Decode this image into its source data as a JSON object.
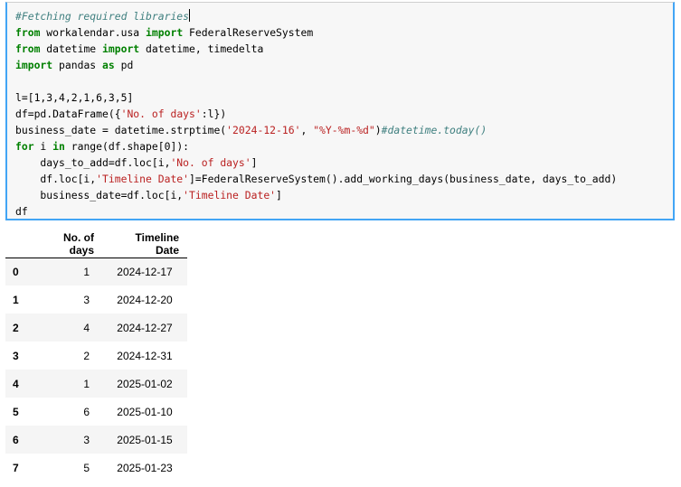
{
  "code_cell": {
    "lines": [
      [
        {
          "t": "cmt",
          "v": "#Fetching required libraries"
        }
      ],
      [
        {
          "t": "kw",
          "v": "from"
        },
        {
          "t": "plain",
          "v": " workalendar.usa "
        },
        {
          "t": "kw",
          "v": "import"
        },
        {
          "t": "plain",
          "v": " FederalReserveSystem"
        }
      ],
      [
        {
          "t": "kw",
          "v": "from"
        },
        {
          "t": "plain",
          "v": " datetime "
        },
        {
          "t": "kw",
          "v": "import"
        },
        {
          "t": "plain",
          "v": " datetime, timedelta"
        }
      ],
      [
        {
          "t": "kw",
          "v": "import"
        },
        {
          "t": "plain",
          "v": " pandas "
        },
        {
          "t": "kw",
          "v": "as"
        },
        {
          "t": "plain",
          "v": " pd"
        }
      ],
      [],
      [
        {
          "t": "plain",
          "v": "l=[1,3,4,2,1,6,3,5]"
        }
      ],
      [
        {
          "t": "plain",
          "v": "df=pd.DataFrame({"
        },
        {
          "t": "str",
          "v": "'No. of days'"
        },
        {
          "t": "plain",
          "v": ":l})"
        }
      ],
      [
        {
          "t": "plain",
          "v": "business_date = datetime.strptime("
        },
        {
          "t": "str",
          "v": "'2024-12-16'"
        },
        {
          "t": "plain",
          "v": ", "
        },
        {
          "t": "str",
          "v": "\"%Y-%m-%d\""
        },
        {
          "t": "plain",
          "v": ")"
        },
        {
          "t": "cmt",
          "v": "#datetime.today()"
        }
      ],
      [
        {
          "t": "kw",
          "v": "for"
        },
        {
          "t": "plain",
          "v": " i "
        },
        {
          "t": "kw",
          "v": "in"
        },
        {
          "t": "plain",
          "v": " range(df.shape[0]):"
        }
      ],
      [
        {
          "t": "plain",
          "v": "    days_to_add=df.loc[i,"
        },
        {
          "t": "str",
          "v": "'No. of days'"
        },
        {
          "t": "plain",
          "v": "]"
        }
      ],
      [
        {
          "t": "plain",
          "v": "    df.loc[i,"
        },
        {
          "t": "str",
          "v": "'Timeline Date'"
        },
        {
          "t": "plain",
          "v": "]=FederalReserveSystem().add_working_days(business_date, days_to_add)"
        }
      ],
      [
        {
          "t": "plain",
          "v": "    business_date=df.loc[i,"
        },
        {
          "t": "str",
          "v": "'Timeline Date'"
        },
        {
          "t": "plain",
          "v": "]"
        }
      ],
      [
        {
          "t": "plain",
          "v": "df"
        }
      ]
    ]
  },
  "output_table": {
    "columns": [
      "",
      "No. of days",
      "Timeline Date"
    ],
    "rows": [
      {
        "index": "0",
        "days": "1",
        "date": "2024-12-17"
      },
      {
        "index": "1",
        "days": "3",
        "date": "2024-12-20"
      },
      {
        "index": "2",
        "days": "4",
        "date": "2024-12-27"
      },
      {
        "index": "3",
        "days": "2",
        "date": "2024-12-31"
      },
      {
        "index": "4",
        "days": "1",
        "date": "2025-01-02"
      },
      {
        "index": "5",
        "days": "6",
        "date": "2025-01-10"
      },
      {
        "index": "6",
        "days": "3",
        "date": "2025-01-15"
      },
      {
        "index": "7",
        "days": "5",
        "date": "2025-01-23"
      }
    ]
  },
  "colors": {
    "cell_border_selected": "#42a5f5",
    "cell_background": "#f7f7f7",
    "keyword": "#008000",
    "string": "#ba2121",
    "comment": "#408080",
    "row_stripe": "#f5f5f5"
  }
}
